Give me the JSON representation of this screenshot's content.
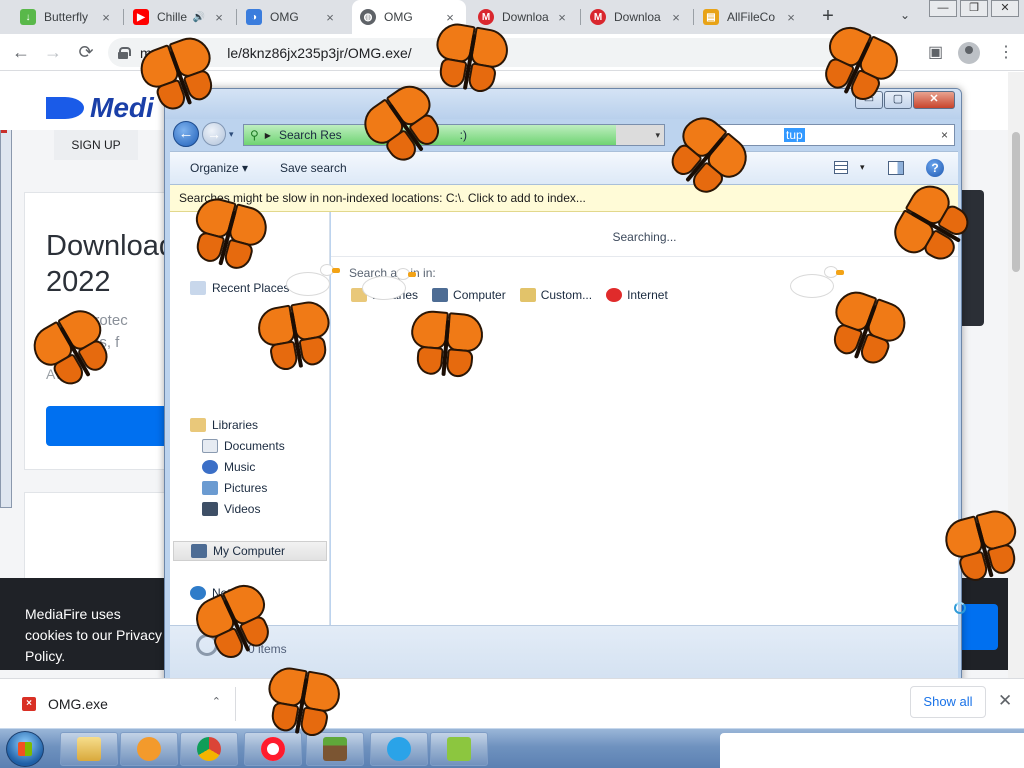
{
  "browser": {
    "tabs": [
      {
        "label": "Butterfly",
        "icon": "download-arrow-icon",
        "color": "#59b84a",
        "active": false
      },
      {
        "label": "Chille",
        "icon": "youtube-icon",
        "color": "#ff0000",
        "active": false,
        "audio": "🔊"
      },
      {
        "label": "OMG",
        "icon": "page-icon",
        "color": "#3b7ddd",
        "active": false
      },
      {
        "label": "OMG",
        "icon": "globe-icon",
        "color": "#5f6368",
        "active": true
      },
      {
        "label": "Downloa",
        "icon": "mega-icon",
        "color": "#d9272e",
        "active": false
      },
      {
        "label": "Downloa",
        "icon": "mega-icon",
        "color": "#d9272e",
        "active": false
      },
      {
        "label": "AllFileCo",
        "icon": "folder-icon",
        "color": "#e8a317",
        "active": false
      }
    ],
    "tab_close": "×",
    "new_tab": "+",
    "tab_search": "⌄",
    "window_buttons": [
      "—",
      "❐",
      "✕"
    ],
    "back": "←",
    "forward": "→",
    "reload": "⟳",
    "url": "med",
    "url_tail": "le/8knz86jx235p3jr/OMG.exe/",
    "share": "⇪",
    "star": "☆",
    "sidepanel": "▣",
    "menu": "⋮"
  },
  "mediafire": {
    "logo": "Medi",
    "signup": "SIGN UP",
    "title": "Download\n2022",
    "subtitle": "protec\nrus, f",
    "avast": "Avast",
    "cookie_text": "MediaFire uses cookies to our Privacy Policy."
  },
  "explorer": {
    "caption": {
      "min": "▭",
      "max": "▢",
      "close": "✕"
    },
    "back": "←",
    "forward": "→",
    "address_text": "Search Res",
    "address_tail": ":)",
    "search_query": "tup",
    "search_clear": "×",
    "organize": "Organize",
    "organize_arrow": "▾",
    "save_search": "Save search",
    "help": "?",
    "infobar": "Searches might be slow in non-indexed locations: C:\\. Click to add to index...",
    "nav": {
      "recent_places": "Recent Places",
      "libraries": "Libraries",
      "documents": "Documents",
      "music": "Music",
      "pictures": "Pictures",
      "videos": "Videos",
      "my_computer": "My Computer",
      "network": "Network"
    },
    "searching": "Searching...",
    "search_again": "Search again in:",
    "search_again_items": [
      "Libraries",
      "Computer",
      "Custom...",
      "Internet"
    ],
    "status_items": "0 items"
  },
  "downloads": {
    "file": "OMG.exe",
    "chevron": "⌃",
    "show_all": "Show all",
    "close": "✕"
  },
  "taskbar": {
    "apps": [
      "explorer-icon",
      "media-player-icon",
      "chrome-icon",
      "opera-icon",
      "minecraft-icon",
      "chat-icon",
      "desktop-goose-icon"
    ],
    "colors": {
      "accent": "#0070f0",
      "butterfly": "#f07a16"
    }
  }
}
